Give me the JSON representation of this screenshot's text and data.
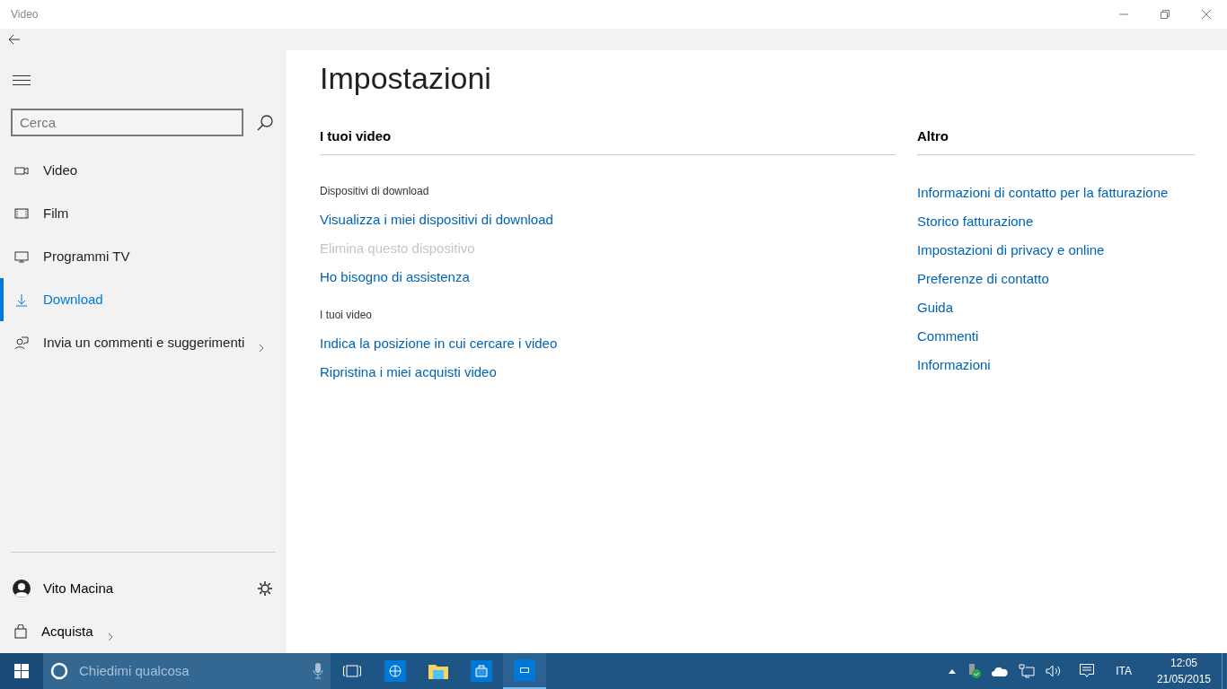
{
  "window": {
    "title": "Video"
  },
  "sidebar": {
    "search": {
      "placeholder": "Cerca"
    },
    "items": [
      {
        "kind": "video",
        "label": "Video",
        "selected": false,
        "chevron": false
      },
      {
        "kind": "film",
        "label": "Film",
        "selected": false,
        "chevron": false
      },
      {
        "kind": "tv",
        "label": "Programmi TV",
        "selected": false,
        "chevron": false
      },
      {
        "kind": "download",
        "label": "Download",
        "selected": true,
        "chevron": false
      },
      {
        "kind": "feedback",
        "label": "Invia un commenti e suggerimenti",
        "selected": false,
        "chevron": true
      }
    ],
    "user": {
      "name": "Vito Macina"
    },
    "store": {
      "label": "Acquista"
    }
  },
  "page": {
    "title": "Impostazioni",
    "left": {
      "heading": "I tuoi video",
      "groups": [
        {
          "label": "Dispositivi di download",
          "links": [
            {
              "text": "Visualizza i miei dispositivi di download",
              "disabled": false
            },
            {
              "text": "Elimina questo dispositivo",
              "disabled": true
            },
            {
              "text": "Ho bisogno di assistenza",
              "disabled": false
            }
          ]
        },
        {
          "label": "I tuoi video",
          "links": [
            {
              "text": "Indica la posizione in cui cercare i video",
              "disabled": false
            },
            {
              "text": "Ripristina i miei acquisti video",
              "disabled": false
            }
          ]
        }
      ]
    },
    "right": {
      "heading": "Altro",
      "links": [
        {
          "text": "Informazioni di contatto per la fatturazione",
          "disabled": false
        },
        {
          "text": "Storico fatturazione",
          "disabled": false
        },
        {
          "text": "Impostazioni di privacy e online",
          "disabled": false
        },
        {
          "text": "Preferenze di contatto",
          "disabled": false
        },
        {
          "text": "Guida",
          "disabled": false
        },
        {
          "text": "Commenti",
          "disabled": false
        },
        {
          "text": "Informazioni",
          "disabled": false
        }
      ]
    }
  },
  "taskbar": {
    "search": {
      "placeholder": "Chiedimi qualcosa"
    },
    "language": "ITA",
    "time": "12:05",
    "date": "21/05/2015"
  }
}
